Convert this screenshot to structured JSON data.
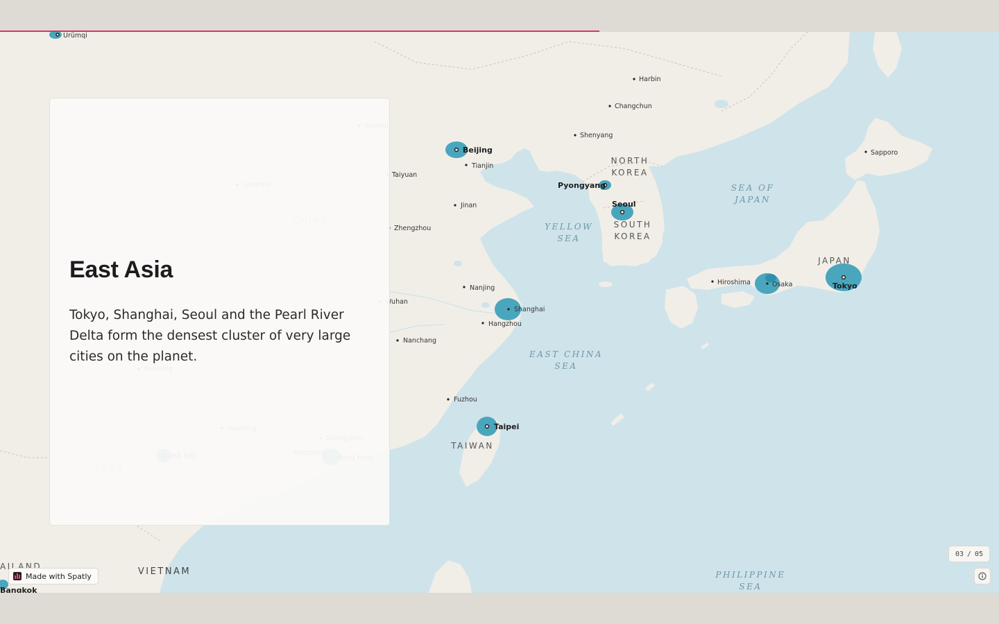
{
  "story": {
    "title": "East Asia",
    "description": "Tokyo, Shanghai, Seoul and the Pearl River Delta form the densest cluster of very large cities on the planet.",
    "progress": 0.6
  },
  "step_counter": {
    "current": "03",
    "separator": "/",
    "total": "05"
  },
  "attribution": {
    "label": "Made with Spatly"
  },
  "colors": {
    "accent": "#d6336c",
    "bubble": "#4aa6bd",
    "water": "#cfe3ea",
    "land": "#f1eee8"
  },
  "icons": {
    "info": "info-icon",
    "logo": "spatly-logo-icon"
  },
  "map": {
    "countries": [
      "NORTH KOREA",
      "SOUTH KOREA",
      "JAPAN",
      "CHINA",
      "TAIWAN",
      "LAOS",
      "VIETNAM",
      "AILAND"
    ],
    "seas": [
      "SEA OF JAPAN",
      "YELLOW SEA",
      "EAST CHINA SEA",
      "PHILIPPINE SEA"
    ],
    "major_cities": [
      "Beijing",
      "Pyongyang",
      "Seoul",
      "Tokyo",
      "Taipei",
      "Bangkok"
    ],
    "minor_cities": [
      "Ürümqi",
      "Harbin",
      "Changchun",
      "Shenyang",
      "Sapporo",
      "Tianjin",
      "Taiyuan",
      "Jinan",
      "Zhengzhou",
      "Nanjing",
      "Wuhan",
      "Shanghai",
      "Hangzhou",
      "Nanchang",
      "Fuzhou",
      "Hiroshima",
      "Osaka",
      "Lanzhou",
      "Baotou",
      "Guangzhou",
      "Shenzhen",
      "Hong Kong",
      "Kunming",
      "Nanning",
      "Hà Nội"
    ]
  }
}
